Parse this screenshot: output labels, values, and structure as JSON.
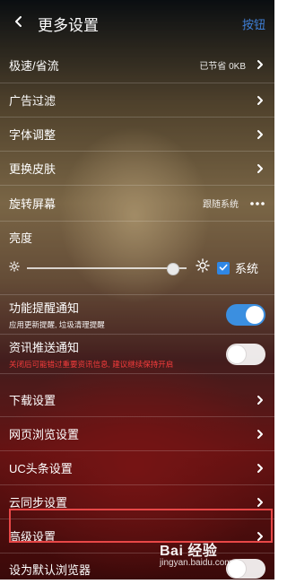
{
  "header": {
    "title": "更多设置",
    "action": "按钮"
  },
  "rows": [
    {
      "label": "极速/省流",
      "value": "已节省 0KB"
    },
    {
      "label": "广告过滤"
    },
    {
      "label": "字体调整"
    },
    {
      "label": "更换皮肤"
    },
    {
      "label": "旋转屏幕",
      "value": "跟随系统"
    }
  ],
  "brightness": {
    "title": "亮度",
    "level_fraction": 0.95,
    "system_label": "系统",
    "system_checked": true
  },
  "toggles": [
    {
      "label": "功能提醒通知",
      "sub": "应用更新提醒, 垃圾清理提醒",
      "on": true
    },
    {
      "label": "资讯推送通知",
      "sub": "关闭后可能错过重要资讯信息, 建议继续保持开启",
      "on": false
    }
  ],
  "rows2": [
    {
      "label": "下载设置"
    },
    {
      "label": "网页浏览设置"
    },
    {
      "label": "UC头条设置"
    },
    {
      "label": "云同步设置"
    },
    {
      "label": "高级设置"
    }
  ],
  "bottom_row": {
    "label": "设为默认浏览器",
    "on": false
  },
  "watermark": {
    "main": "Bai 经验",
    "sub": "jingyan.baidu.com"
  },
  "colors": {
    "accent": "#3b8fe0",
    "highlight": "#e84747"
  }
}
